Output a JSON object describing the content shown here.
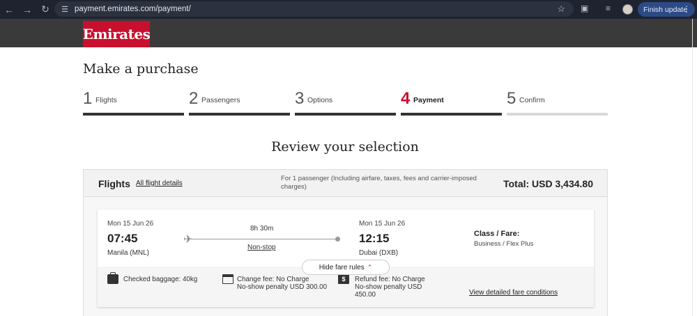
{
  "browser": {
    "url": "payment.emirates.com/payment/",
    "finish_update_label": "Finish update"
  },
  "site": {
    "logo": "Emirates",
    "page_title": "Make a purchase"
  },
  "steps": [
    {
      "num": "1",
      "label": "Flights",
      "state": "done"
    },
    {
      "num": "2",
      "label": "Passengers",
      "state": "done"
    },
    {
      "num": "3",
      "label": "Options",
      "state": "done"
    },
    {
      "num": "4",
      "label": "Payment",
      "state": "active"
    },
    {
      "num": "5",
      "label": "Confirm",
      "state": "pending"
    }
  ],
  "review": {
    "title": "Review your selection"
  },
  "flights": {
    "title": "Flights",
    "all_details_link": "All flight details",
    "passenger_note": "For 1 passenger (Including airfare, taxes, fees and carrier-imposed charges)",
    "total": "Total: USD 3,434.80",
    "segment": {
      "departure": {
        "date": "Mon 15 Jun 26",
        "time": "07:45",
        "city": "Manila (MNL)"
      },
      "arrival": {
        "date": "Mon 15 Jun 26",
        "time": "12:15",
        "city": "Dubai (DXB)"
      },
      "duration": "8h 30m",
      "stops": "Non-stop",
      "class_label": "Class / Fare:",
      "class_value": "Business / Flex Plus"
    },
    "fare_rules": {
      "baggage": "Checked baggage: 40kg",
      "change_fee_line1": "Change fee: No Charge",
      "change_fee_line2": "No-show penalty USD 300.00",
      "refund_fee_line1": "Refund fee: No Charge",
      "refund_fee_line2": "No-show penalty USD",
      "refund_fee_line3": "450.00",
      "view_conditions_link": "View detailed fare conditions",
      "hide_rules_label": "Hide fare rules"
    }
  },
  "colors": {
    "brand_red": "#c8102e",
    "header_dark": "#3a3a3a"
  }
}
